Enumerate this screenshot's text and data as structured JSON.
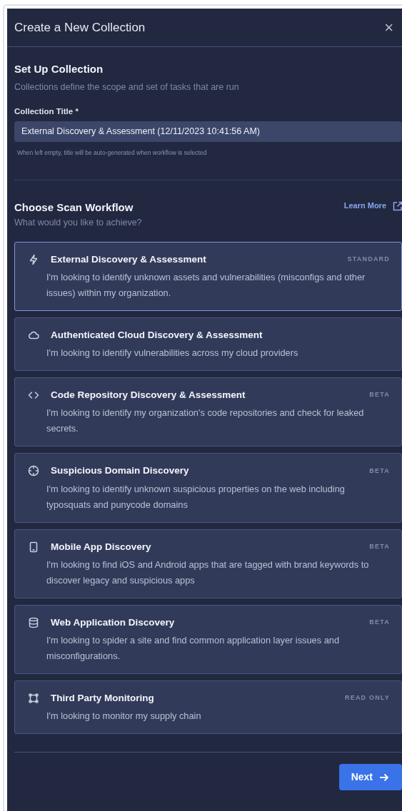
{
  "dialog": {
    "title": "Create a New Collection",
    "close": "×"
  },
  "setup": {
    "heading": "Set Up Collection",
    "subtitle": "Collections define the scope and set of tasks that are run",
    "field_label": "Collection Title *",
    "field_value": "External Discovery & Assessment (12/11/2023 10:41:56 AM)",
    "hint": "When left empty, title will be auto-generated when workflow is selected"
  },
  "workflow": {
    "heading": "Choose Scan Workflow",
    "subtitle": "What would you like to achieve?",
    "learn_more": "Learn More",
    "options": [
      {
        "title": "External Discovery & Assessment",
        "badge": "STANDARD",
        "description": "I'm looking to identify unknown assets and vulnerabilities (misconfigs and other issues) within my organization.",
        "selected": true
      },
      {
        "title": "Authenticated Cloud Discovery & Assessment",
        "description": "I'm looking to identify vulnerabilities across my cloud providers",
        "selected": false
      },
      {
        "title": "Code Repository Discovery & Assessment",
        "badge": "BETA",
        "description": "I'm looking to identify my organization's code repositories and check for leaked secrets.",
        "selected": false
      },
      {
        "title": "Suspicious Domain Discovery",
        "badge": "BETA",
        "description": "I'm looking to identify unknown suspicious properties on the web including typosquats and punycode domains",
        "selected": false
      },
      {
        "title": "Mobile App Discovery",
        "badge": "BETA",
        "description": "I'm looking to find iOS and Android apps that are tagged with brand keywords to discover legacy and suspicious apps",
        "selected": false
      },
      {
        "title": "Web Application Discovery",
        "badge": "BETA",
        "description": "I'm looking to spider a site and find common application layer issues and misconfigurations.",
        "selected": false
      },
      {
        "title": "Third Party Monitoring",
        "badge": "READ ONLY",
        "description": "I'm looking to monitor my supply chain",
        "selected": false
      }
    ]
  },
  "footer": {
    "next": "Next"
  }
}
